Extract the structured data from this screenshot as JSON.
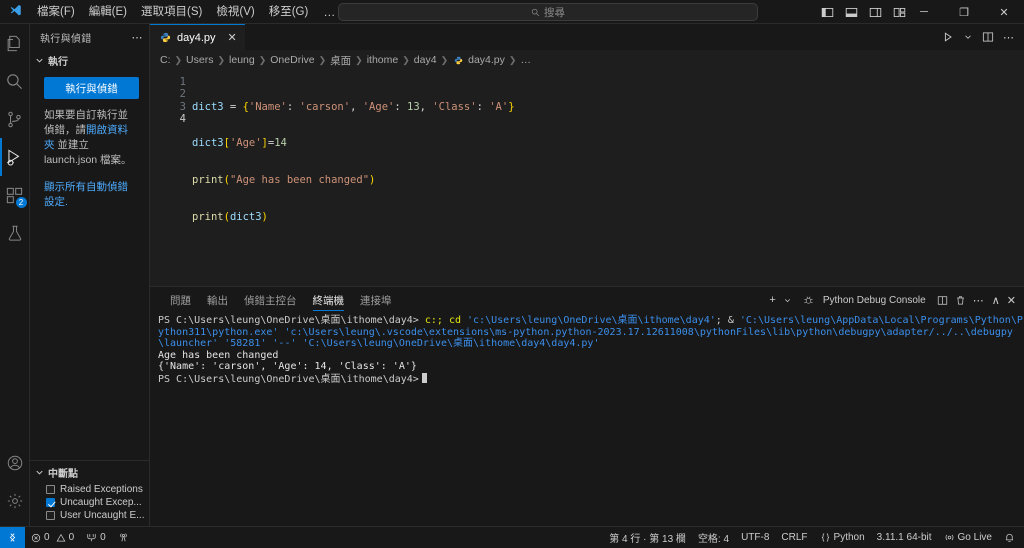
{
  "titlebar": {
    "menu": [
      {
        "label": "檔案(F)",
        "name": "menu-file"
      },
      {
        "label": "編輯(E)",
        "name": "menu-edit"
      },
      {
        "label": "選取項目(S)",
        "name": "menu-selection"
      },
      {
        "label": "檢視(V)",
        "name": "menu-view"
      },
      {
        "label": "移至(G)",
        "name": "menu-go"
      }
    ],
    "more": "…",
    "back": "←",
    "forward": "→",
    "search_placeholder": "搜尋",
    "minimize": "─",
    "maximize": "❐",
    "close": "✕"
  },
  "activitybar": {
    "explorer": "explorer-icon",
    "search": "search-icon",
    "source_control": "source-control-icon",
    "run_debug": "run-and-debug-icon",
    "extensions": "extensions-icon",
    "extensions_badge": "2",
    "testing": "testing-flask-icon",
    "account": "account-icon",
    "settings": "settings-gear-icon"
  },
  "sidebar": {
    "title": "執行與偵錯",
    "more": "⋯",
    "run_section_label": "執行",
    "run_button": "執行與偵錯",
    "description_pre": "如果要自訂執行並偵錯，請",
    "description_link": "開啟資料夾",
    "description_post": " 並建立 launch.json 檔案。",
    "show_all_link": "顯示所有自動偵錯設定.",
    "breakpoints_label": "中斷點",
    "breakpoints": [
      {
        "label": "Raised Exceptions",
        "checked": false
      },
      {
        "label": "Uncaught Excep...",
        "checked": true
      },
      {
        "label": "User Uncaught E...",
        "checked": false
      }
    ]
  },
  "editor": {
    "tab": {
      "label": "day4.py",
      "close": "✕",
      "icon": "python-file-icon"
    },
    "actions": {
      "run": "run-python-file-icon",
      "chevron": "chevron-down-icon",
      "split": "split-editor-icon",
      "more": "⋯"
    },
    "breadcrumb": [
      "C:",
      "Users",
      "leung",
      "OneDrive",
      "桌面",
      "ithome",
      "day4",
      "day4.py",
      "…"
    ],
    "line_numbers": [
      "1",
      "2",
      "3",
      "4"
    ],
    "current_line": 4,
    "code_lines": [
      "dict3 = {'Name': 'carson', 'Age': 13, 'Class': 'A'}",
      "dict3['Age']=14",
      "print(\"Age has been changed\")",
      "print(dict3)"
    ]
  },
  "panel": {
    "tabs": [
      {
        "label": "問題",
        "active": false
      },
      {
        "label": "輸出",
        "active": false
      },
      {
        "label": "偵錯主控台",
        "active": false
      },
      {
        "label": "終端機",
        "active": true
      },
      {
        "label": "連接埠",
        "active": false
      }
    ],
    "actions": {
      "new_terminal": "+",
      "new_chevron": "chevron-down-icon",
      "console_name": "Python Debug Console",
      "split": "split-terminal-icon",
      "kill": "trash-icon",
      "more": "⋯",
      "maximize": "∧",
      "close": "✕"
    },
    "terminal": {
      "prompt1": "PS C:\\Users\\leung\\OneDrive\\桌面\\ithome\\day4> ",
      "cmd_drive": "c:;",
      "cmd_cd": "cd",
      "cmd_path": " 'c:\\Users\\leung\\OneDrive\\桌面\\ithome\\day4'",
      "cmd_amp": "; & ",
      "cmd_python": "'C:\\Users\\leung\\AppData\\Local\\Programs\\Python\\Python311\\python.exe' ",
      "cmd_launcher": "'c:\\Users\\leung\\.vscode\\extensions\\ms-python.python-2023.17.12611008\\pythonFiles\\lib\\python\\debugpy\\adapter/../..\\debugpy\\launcher' ",
      "cmd_port": "'58281' ",
      "cmd_sep": "'--' ",
      "cmd_script": "'C:\\Users\\leung\\OneDrive\\桌面\\ithome\\day4\\day4.py'",
      "output1": "Age has been changed",
      "output2": "{'Name': 'carson', 'Age': 14, 'Class': 'A'}",
      "prompt2": "PS C:\\Users\\leung\\OneDrive\\桌面\\ithome\\day4>"
    }
  },
  "statusbar": {
    "remote": "remote-window-icon",
    "errors": "0",
    "warnings": "0",
    "ports": "0",
    "radio_tower": "radio-tower-icon",
    "cursor_position": "第 4 行 · 第 13 欄",
    "indentation": "空格: 4",
    "encoding": "UTF-8",
    "eol": "CRLF",
    "language": "Python",
    "interpreter": "3.11.1 64-bit",
    "go_live": "Go Live",
    "bell": "bell-icon"
  }
}
